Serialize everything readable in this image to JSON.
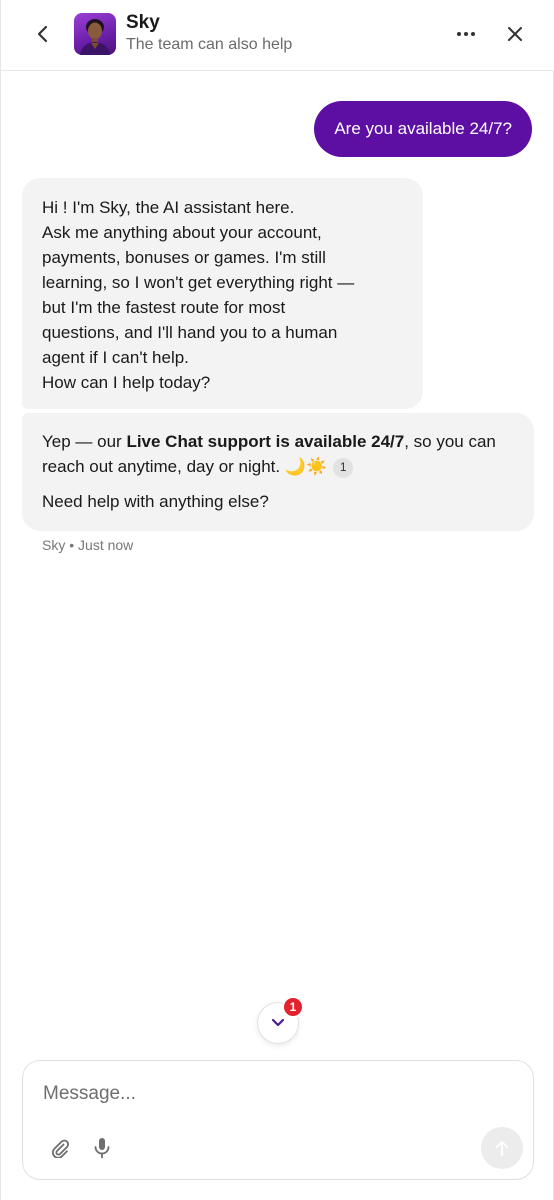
{
  "header": {
    "title": "Sky",
    "subtitle": "The team can also help",
    "back_icon": "chevron-left-icon",
    "more_icon": "more-horizontal-icon",
    "close_icon": "close-icon"
  },
  "messages": {
    "user_1": "Are you available 24/7?",
    "bot_1": {
      "lines": [
        "Hi ! I'm Sky, the AI assistant here.",
        "Ask me anything about your account,",
        "payments, bonuses or games. I'm still",
        "learning, so I won't get everything right —",
        "but I'm the fastest route for most",
        "questions, and I'll hand you to a human",
        "agent if I can't help.",
        "How can I help today?"
      ]
    },
    "bot_2": {
      "prefix": "Yep — our ",
      "bold": "Live Chat support is available 24/7",
      "suffix": ", so you can reach out anytime, day or night. 🌙☀️",
      "citation": "1",
      "followup": "Need help with anything else?"
    },
    "meta": {
      "sender": "Sky",
      "separator": "•",
      "time": "Just now"
    }
  },
  "scroll": {
    "icon": "chevron-down-icon",
    "badge_count": "1"
  },
  "composer": {
    "placeholder": "Message...",
    "attach_icon": "paperclip-icon",
    "mic_icon": "microphone-icon",
    "send_icon": "arrow-up-icon"
  },
  "colors": {
    "user_bubble": "#5d0fa3",
    "bot_bubble": "#f3f3f3",
    "badge": "#e3222e",
    "send_disabled": "#ececec"
  }
}
